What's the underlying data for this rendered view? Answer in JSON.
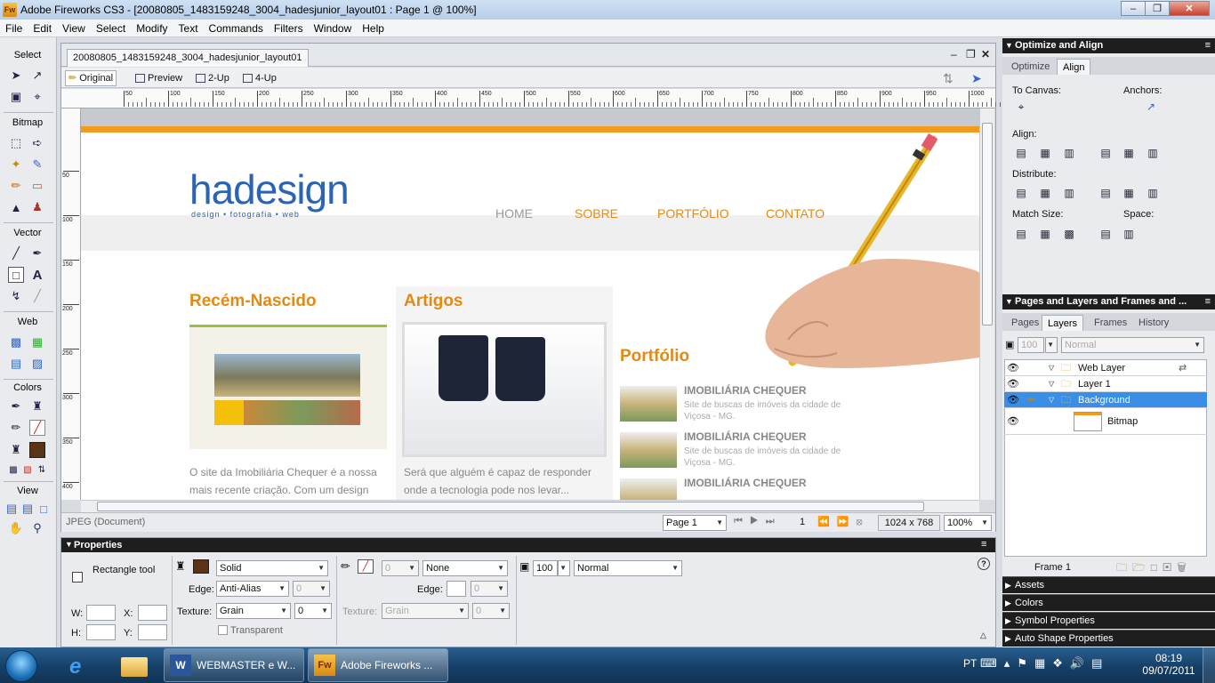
{
  "window": {
    "title": "Adobe Fireworks CS3 - [20080805_1483159248_3004_hadesjunior_layout01 : Page 1 @ 100%]",
    "app_icon": "Fw"
  },
  "menu": [
    "File",
    "Edit",
    "View",
    "Select",
    "Modify",
    "Text",
    "Commands",
    "Filters",
    "Window",
    "Help"
  ],
  "tools": {
    "sections": [
      "Select",
      "Bitmap",
      "Vector",
      "Web",
      "Colors",
      "View"
    ]
  },
  "doc": {
    "tab": "20080805_1483159248_3004_hadesjunior_layout01",
    "views": [
      "Original",
      "Preview",
      "2-Up",
      "4-Up"
    ],
    "ruler_top": [
      "50",
      "100",
      "150",
      "200",
      "250",
      "300",
      "350",
      "400",
      "450",
      "500",
      "550",
      "600",
      "650",
      "700",
      "750",
      "800",
      "850",
      "900",
      "950",
      "1000"
    ],
    "ruler_left": [
      "50",
      "100",
      "150",
      "200",
      "250",
      "300",
      "350",
      "400"
    ],
    "status": {
      "left": "JPEG (Document)",
      "page": "Page 1",
      "frame": "1",
      "size": "1024 x 768",
      "zoom": "100%"
    }
  },
  "site": {
    "logo": "hadesign",
    "tagline": "design • fotografia • web",
    "nav": [
      "HOME",
      "SOBRE",
      "PORTFÓLIO",
      "CONTATO"
    ],
    "col1": {
      "title": "Recém-Nascido",
      "text1": "O site da Imobiliária Chequer é a nossa",
      "text2": "mais recente criação. Com um design"
    },
    "col2": {
      "title": "Artigos",
      "text1": "Será que alguém é capaz de responder",
      "text2": "onde a tecnologia pode nos levar..."
    },
    "col3": {
      "title": "Portfólio",
      "items": [
        {
          "title": "IMOBILIÁRIA CHEQUER",
          "desc1": "Site de buscas de imóveis da cidade de",
          "desc2": "Viçosa - MG."
        },
        {
          "title": "IMOBILIÁRIA CHEQUER",
          "desc1": "Site de buscas de imóveis da cidade de",
          "desc2": "Viçosa - MG."
        },
        {
          "title": "IMOBILIÁRIA CHEQUER",
          "desc1": "",
          "desc2": ""
        }
      ]
    }
  },
  "properties": {
    "title": "Properties",
    "tool": "Rectangle tool",
    "w_label": "W:",
    "x_label": "X:",
    "h_label": "H:",
    "y_label": "Y:",
    "fill": "Solid",
    "edge_label": "Edge:",
    "edge": "Anti-Alias",
    "edge_val": "0",
    "texture_label": "Texture:",
    "texture": "Grain",
    "texture_val": "0",
    "transparent": "Transparent",
    "stroke_size": "0",
    "stroke": "None",
    "stroke_edge_label": "Edge:",
    "stroke_edge_val": "0",
    "stroke_texture_label": "Texture:",
    "stroke_texture": "Grain",
    "stroke_texture_val": "0",
    "opacity": "100",
    "blend": "Normal"
  },
  "optimize_panel": {
    "title": "Optimize and Align",
    "tabs": [
      "Optimize",
      "Align"
    ],
    "to_canvas": "To Canvas:",
    "anchors": "Anchors:",
    "align": "Align:",
    "distribute": "Distribute:",
    "match_size": "Match Size:",
    "space": "Space:"
  },
  "layers_panel": {
    "title": "Pages and Layers and Frames and ...",
    "tabs": [
      "Pages",
      "Layers",
      "Frames",
      "History"
    ],
    "opacity": "100",
    "blend": "Normal",
    "rows": [
      "Web Layer",
      "Layer 1",
      "Background",
      "Bitmap"
    ],
    "frame": "Frame 1"
  },
  "collapsed_panels": [
    "Assets",
    "Colors",
    "Symbol Properties",
    "Auto Shape Properties"
  ],
  "taskbar": {
    "word": "WEBMASTER e W...",
    "fireworks": "Adobe Fireworks ...",
    "lang": "PT",
    "time": "08:19",
    "date": "09/07/2011"
  },
  "colors": {
    "accent": "#e38a14",
    "fill_swatch": "#5a3414",
    "selection": "#3a8ee6"
  }
}
